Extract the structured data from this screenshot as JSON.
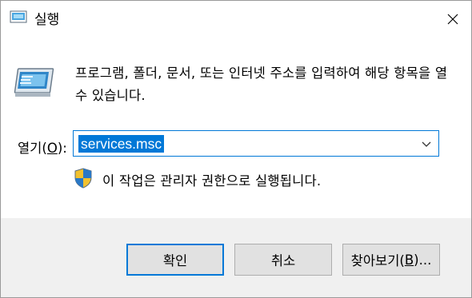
{
  "window": {
    "title": "실행"
  },
  "dialog": {
    "description": "프로그램, 폴더, 문서, 또는 인터넷 주소를 입력하여 해당 항목을 열 수 있습니다.",
    "open_label_prefix": "열기(",
    "open_label_key": "O",
    "open_label_suffix": "):",
    "open_value": "services.msc",
    "admin_notice": "이 작업은 관리자 권한으로 실행됩니다."
  },
  "buttons": {
    "ok_label": "확인",
    "cancel_label": "취소",
    "browse_prefix": "찾아보기(",
    "browse_key": "B",
    "browse_suffix": ")..."
  },
  "icons": {
    "title": "run-icon",
    "close": "close-icon",
    "dropdown": "chevron-down-icon",
    "admin": "uac-shield-icon"
  },
  "colors": {
    "accent": "#0078d7",
    "footer_bg": "#f0f0f0",
    "button_bg": "#e1e1e1"
  }
}
